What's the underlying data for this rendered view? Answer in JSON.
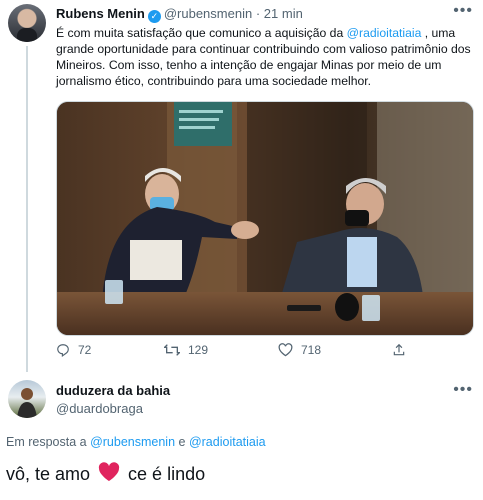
{
  "tweet1": {
    "name": "Rubens Menin",
    "handle": "@rubensmenin",
    "separator": "·",
    "time": "21 min",
    "text": {
      "p1": "É com muita satisfação que comunico a aquisição da ",
      "mention": "@radioitatiaia",
      "p2": " , uma grande oportunidade para continuar contribuindo com valioso patrimônio dos Mineiros. Com isso, tenho a intenção de engajar Minas por meio de um jornalismo ético, contribuindo para uma sociedade melhor."
    },
    "actions": {
      "reply_count": "72",
      "retweet_count": "129",
      "like_count": "718"
    }
  },
  "tweet2": {
    "name": "duduzera da bahia",
    "handle": "@duardobraga",
    "reply_prefix": "Em resposta a ",
    "reply_user1": "@rubensmenin",
    "reply_and": " e ",
    "reply_user2": "@radioitatiaia",
    "text_before": "vô, te amo",
    "text_after": "ce é lindo"
  },
  "colors": {
    "accent": "#1d9bf0",
    "muted": "#536471",
    "heart": "#e0245e"
  },
  "icons": [
    "verified-badge-icon",
    "more-icon",
    "reply-icon",
    "retweet-icon",
    "like-icon",
    "share-icon",
    "heart-emoji"
  ]
}
